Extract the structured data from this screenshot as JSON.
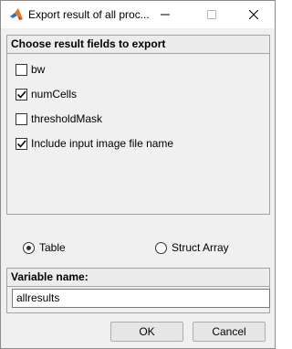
{
  "window": {
    "title": "Export result of all proc..."
  },
  "fields_group": {
    "header": "Choose result fields to export",
    "items": [
      {
        "label": "bw",
        "checked": false
      },
      {
        "label": "numCells",
        "checked": true
      },
      {
        "label": "thresholdMask",
        "checked": false
      },
      {
        "label": "Include input image file name",
        "checked": true
      }
    ]
  },
  "format": {
    "options": [
      {
        "label": "Table",
        "selected": true
      },
      {
        "label": "Struct Array",
        "selected": false
      }
    ]
  },
  "variable": {
    "header": "Variable name:",
    "value": "allresults"
  },
  "buttons": {
    "ok": "OK",
    "cancel": "Cancel"
  }
}
